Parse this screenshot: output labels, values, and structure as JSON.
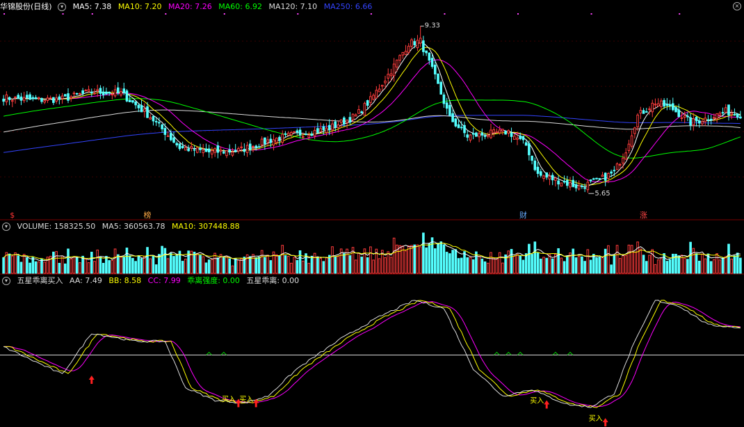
{
  "header_price": {
    "title": "华锦股份(日线)",
    "items": [
      {
        "label": "MA5: 7.38",
        "color": "#ffffff"
      },
      {
        "label": "MA10: 7.20",
        "color": "#ffff00"
      },
      {
        "label": "MA20: 7.26",
        "color": "#ff00ff"
      },
      {
        "label": "MA60: 6.92",
        "color": "#00ff00"
      },
      {
        "label": "MA120: 7.10",
        "color": "#dddddd"
      },
      {
        "label": "MA250: 6.66",
        "color": "#3344ff"
      }
    ]
  },
  "header_volume": {
    "items": [
      {
        "label": "VOLUME: 158325.50",
        "color": "#dddddd"
      },
      {
        "label": "MA5: 360563.78",
        "color": "#dddddd"
      },
      {
        "label": "MA10: 307448.88",
        "color": "#ffff00"
      }
    ]
  },
  "header_indicator": {
    "items": [
      {
        "label": "五星乖离买入",
        "color": "#dddddd"
      },
      {
        "label": "AA: 7.49",
        "color": "#dddddd"
      },
      {
        "label": "BB: 8.58",
        "color": "#ffff00"
      },
      {
        "label": "CC: 7.99",
        "color": "#ff00ff"
      },
      {
        "label": "乖离强度: 0.00",
        "color": "#00ff00"
      },
      {
        "label": "五星乖离: 0.00",
        "color": "#dddddd"
      }
    ]
  },
  "chart_data": [
    {
      "type": "candlestick",
      "title": "华锦股份(日线)",
      "price_range": [
        5.3,
        9.6
      ],
      "annotations": {
        "high": {
          "label": "9.33",
          "value": 9.33
        },
        "low": {
          "label": "5.65",
          "value": 5.65
        }
      },
      "event_markers": [
        {
          "label": "$",
          "color": "#ff3333"
        },
        {
          "label": "榜",
          "color": "#ffaa44"
        },
        {
          "label": "财",
          "color": "#66aaff"
        },
        {
          "label": "涨",
          "color": "#ff4444"
        }
      ],
      "close_anchors": [
        [
          0,
          7.75
        ],
        [
          10,
          7.7
        ],
        [
          20,
          7.72
        ],
        [
          30,
          7.88
        ],
        [
          40,
          7.85
        ],
        [
          50,
          7.33
        ],
        [
          60,
          6.65
        ],
        [
          70,
          6.55
        ],
        [
          80,
          6.58
        ],
        [
          90,
          6.8
        ],
        [
          100,
          6.95
        ],
        [
          110,
          7.05
        ],
        [
          120,
          7.35
        ],
        [
          125,
          7.7
        ],
        [
          132,
          8.35
        ],
        [
          138,
          8.95
        ],
        [
          142,
          9.0
        ],
        [
          147,
          8.2
        ],
        [
          152,
          7.3
        ],
        [
          158,
          6.9
        ],
        [
          165,
          6.95
        ],
        [
          172,
          7.0
        ],
        [
          178,
          6.7
        ],
        [
          182,
          6.05
        ],
        [
          190,
          5.9
        ],
        [
          196,
          5.78
        ],
        [
          202,
          5.9
        ],
        [
          208,
          6.1
        ],
        [
          212,
          6.6
        ],
        [
          216,
          7.35
        ],
        [
          222,
          7.65
        ],
        [
          228,
          7.5
        ],
        [
          234,
          7.2
        ],
        [
          240,
          7.3
        ],
        [
          246,
          7.45
        ],
        [
          251,
          7.38
        ]
      ]
    },
    {
      "type": "bar",
      "title": "VOLUME",
      "series": [
        {
          "name": "VOLUME"
        },
        {
          "name": "MA5"
        },
        {
          "name": "MA10"
        }
      ],
      "latest": {
        "VOLUME": 158325.5,
        "MA5": 360563.78,
        "MA10": 307448.88
      }
    },
    {
      "type": "line",
      "title": "五星乖离买入",
      "y_range": [
        0,
        100
      ],
      "baseline": 50,
      "series": [
        {
          "name": "AA",
          "color": "#dddddd",
          "last": 7.49
        },
        {
          "name": "BB",
          "color": "#ffff00",
          "last": 8.58
        },
        {
          "name": "CC",
          "color": "#ff00ff",
          "last": 7.99
        }
      ],
      "aa_anchors": [
        [
          0,
          56
        ],
        [
          8,
          48
        ],
        [
          20,
          36
        ],
        [
          30,
          66
        ],
        [
          45,
          60
        ],
        [
          55,
          60
        ],
        [
          62,
          26
        ],
        [
          72,
          17
        ],
        [
          82,
          15
        ],
        [
          90,
          20
        ],
        [
          100,
          40
        ],
        [
          115,
          62
        ],
        [
          128,
          78
        ],
        [
          140,
          90
        ],
        [
          150,
          84
        ],
        [
          160,
          40
        ],
        [
          170,
          20
        ],
        [
          180,
          25
        ],
        [
          185,
          20
        ],
        [
          192,
          14
        ],
        [
          200,
          12
        ],
        [
          208,
          22
        ],
        [
          214,
          55
        ],
        [
          222,
          90
        ],
        [
          230,
          86
        ],
        [
          240,
          72
        ],
        [
          251,
          70
        ]
      ],
      "buy_signal_label": "买入",
      "buy_signals": [
        {
          "x": 30,
          "label": "",
          "level": 35
        },
        {
          "x": 80,
          "label": "买入",
          "level": 18
        },
        {
          "x": 86,
          "label": "买入",
          "level": 18
        },
        {
          "x": 185,
          "label": "买入",
          "level": 17
        },
        {
          "x": 205,
          "label": "买入",
          "level": 4
        }
      ]
    }
  ]
}
